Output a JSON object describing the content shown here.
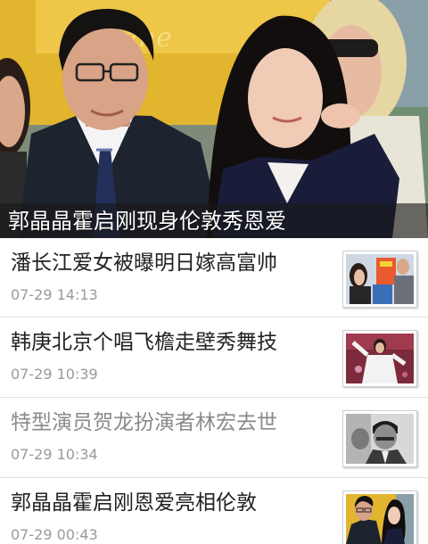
{
  "hero": {
    "caption": "郭晶晶霍启刚现身伦敦秀恩爱",
    "photo_icon": "hero-photo"
  },
  "news": [
    {
      "title": "潘长江爱女被曝明日嫁高富帅",
      "time": "07-29 14:13",
      "read": false,
      "thumb": "thumbnail-image"
    },
    {
      "title": "韩庚北京个唱飞檐走壁秀舞技",
      "time": "07-29 10:39",
      "read": false,
      "thumb": "thumbnail-image"
    },
    {
      "title": "特型演员贺龙扮演者林宏去世",
      "time": "07-29 10:34",
      "read": true,
      "thumb": "thumbnail-image"
    },
    {
      "title": "郭晶晶霍启刚恩爱亮相伦敦",
      "time": "07-29 00:43",
      "read": false,
      "thumb": "thumbnail-image"
    }
  ],
  "colors": {
    "title": "#222222",
    "title_read": "#8a8a8a",
    "time": "#9a9a9a",
    "divider": "#e1e1e1",
    "caption_bg": "rgba(25,25,25,0.62)"
  }
}
